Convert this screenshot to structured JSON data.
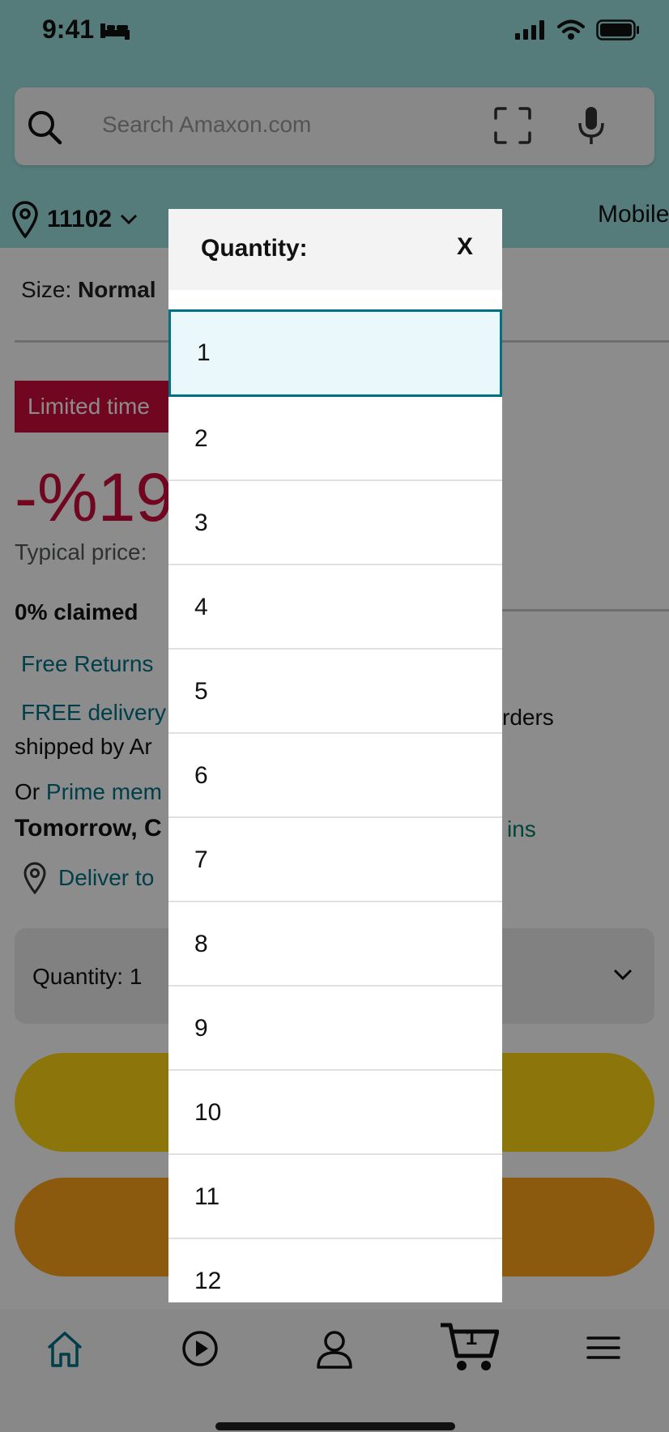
{
  "status_bar": {
    "time": "9:41"
  },
  "search": {
    "placeholder": "Search Amaxon.com"
  },
  "location": {
    "zip": "11102"
  },
  "categories": [
    "Mobile"
  ],
  "product": {
    "size_label": "Size:",
    "size_value": "Normal",
    "limited_badge": "Limited time",
    "discount": "-%19",
    "typical_price": "Typical price:",
    "claimed": "0% claimed",
    "free_returns": "Free Returns",
    "free_delivery_link": "FREE delivery",
    "free_delivery_tail": "rders",
    "shipped_by": "shipped by Ar",
    "or_text": "Or",
    "prime_link": "Prime mem",
    "tomorrow": "Tomorrow, C",
    "mins": "ins",
    "deliver_to": "Deliver to"
  },
  "quantity_select": {
    "label": "Quantity: 1"
  },
  "modal": {
    "title": "Quantity:",
    "close": "X",
    "selected": "1",
    "options": [
      "1",
      "2",
      "3",
      "4",
      "5",
      "6",
      "7",
      "8",
      "9",
      "10",
      "11",
      "12"
    ]
  },
  "bottom_nav": {
    "cart_count": "1"
  },
  "colors": {
    "header_bg": "#9de0e0",
    "accent": "#007185",
    "deal_red": "#cc0c39",
    "add_to_cart": "#ffd814",
    "buy_now": "#ffa41c",
    "eta_green": "#067d62"
  }
}
